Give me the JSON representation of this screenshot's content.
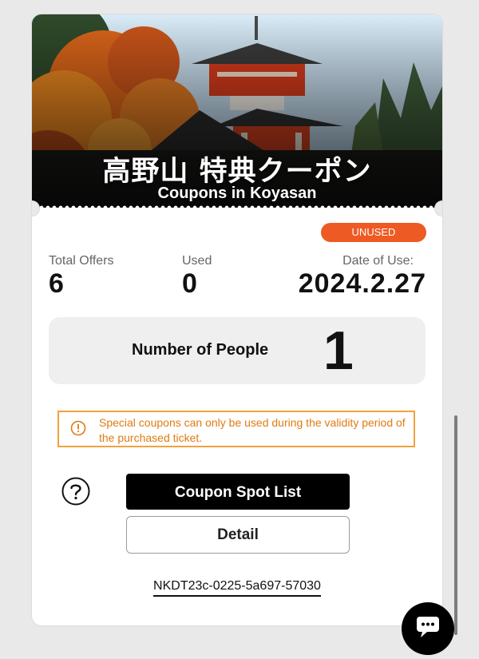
{
  "hero": {
    "title": "高野山 特典クーポン",
    "subtitle": "Coupons in Koyasan"
  },
  "status": {
    "label": "UNUSED",
    "color": "#ee5a24"
  },
  "stats": {
    "total_offers_label": "Total Offers",
    "total_offers_value": "6",
    "used_label": "Used",
    "used_value": "0",
    "date_label": "Date of Use:",
    "date_value": "2024.2.27"
  },
  "people": {
    "label": "Number of People",
    "value": "1"
  },
  "notice": {
    "text": "Special coupons can only be used during the validity period of the purchased ticket.",
    "icon": "alert-circle-icon",
    "color": "#f2a23c"
  },
  "actions": {
    "help_icon": "question-circle-icon",
    "coupon_spot_list_label": "Coupon Spot List",
    "detail_label": "Detail"
  },
  "ticket": {
    "code": "NKDT23c-0225-5a697-57030"
  },
  "chat": {
    "icon": "chat-bubble-icon"
  }
}
